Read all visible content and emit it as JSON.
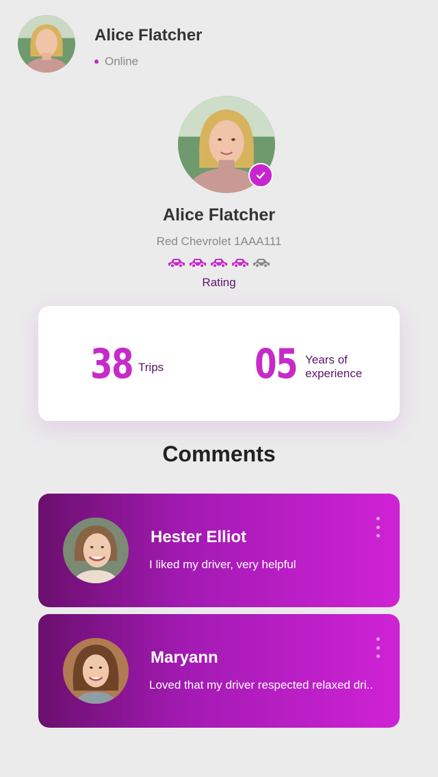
{
  "header": {
    "name": "Alice Flatcher",
    "status": "Online"
  },
  "profile": {
    "name": "Alice Flatcher",
    "car": "Red Chevrolet 1AAA111",
    "rating_label": "Rating",
    "rating_value": 4,
    "rating_max": 5,
    "rating_icon": "car-icon",
    "verified_icon": "check-icon"
  },
  "stats": {
    "trips_value": "38",
    "trips_label": "Trips",
    "years_value": "05",
    "years_label_1": "Years of",
    "years_label_2": "experience"
  },
  "comments": {
    "title": "Comments",
    "items": [
      {
        "name": "Hester Elliot",
        "text": "I liked my driver, very helpful"
      },
      {
        "name": "Maryann",
        "text": "Loved that my driver respected relaxed dri.."
      }
    ]
  },
  "colors": {
    "accent": "#c62bc9",
    "accent_dark": "#5a1668",
    "background": "#ebebeb",
    "card_gradient_start": "#6a0f6d",
    "card_gradient_end": "#cf22d6",
    "inactive_star": "#8a8a8a"
  }
}
